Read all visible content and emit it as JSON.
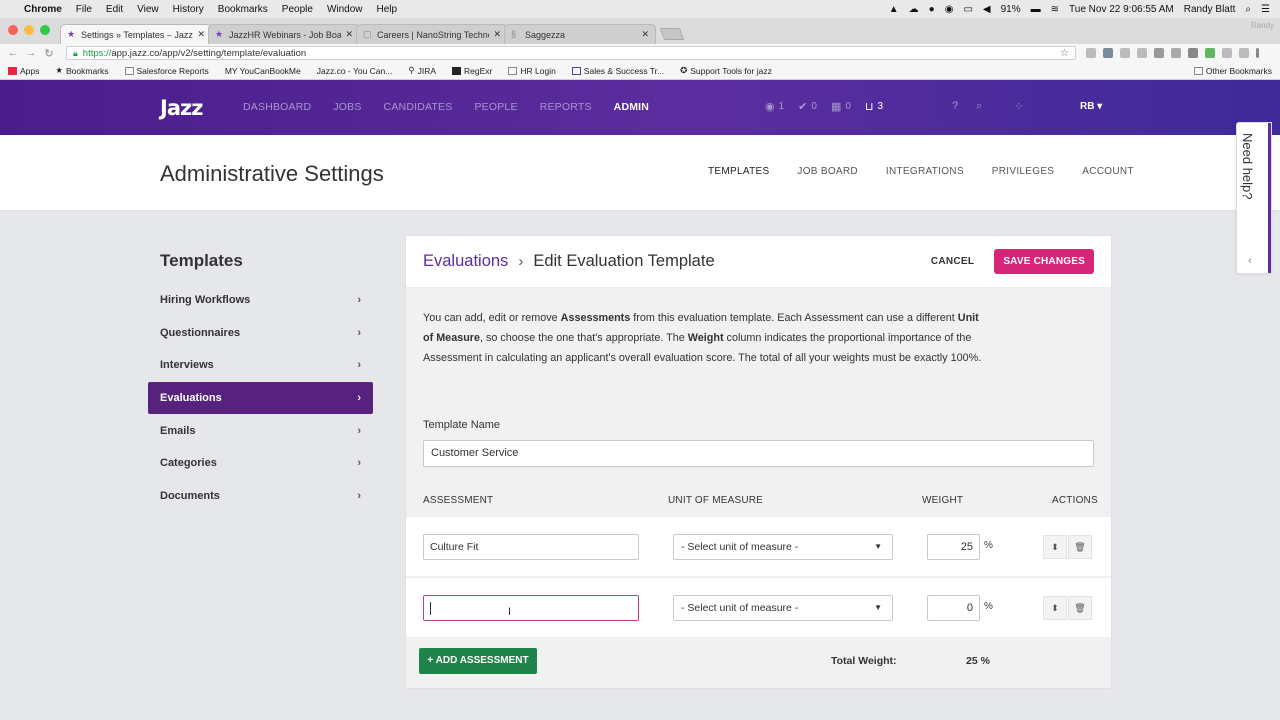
{
  "menubar": {
    "app": "Chrome",
    "items": [
      "File",
      "Edit",
      "View",
      "History",
      "Bookmarks",
      "People",
      "Window",
      "Help"
    ],
    "battery": "91%",
    "datetime": "Tue Nov 22  9:06:55 AM",
    "user": "Randy Blatt"
  },
  "browser": {
    "tabs": [
      {
        "title": "Settings » Templates – Jazz",
        "active": true
      },
      {
        "title": "JazzHR Webinars - Job Board",
        "active": false
      },
      {
        "title": "Careers | NanoString Technolo",
        "active": false
      },
      {
        "title": "Saggezza",
        "active": false
      }
    ],
    "profile": "Randy",
    "url_secure": "https://",
    "url_rest": "app.jazz.co/app/v2/setting/template/evaluation",
    "bookmarks": [
      "Apps",
      "Bookmarks",
      "Salesforce Reports",
      "MY YouCanBookMe",
      "Jazz.co - You Can...",
      "JIRA",
      "RegExr",
      "HR Login",
      "Sales & Success Tr...",
      "Support Tools for jazz"
    ],
    "other_bookmarks": "Other Bookmarks"
  },
  "app": {
    "logo": "Jazz",
    "nav": [
      "DASHBOARD",
      "JOBS",
      "CANDIDATES",
      "PEOPLE",
      "REPORTS",
      "ADMIN"
    ],
    "active_nav": "ADMIN",
    "counters": {
      "eye": "1",
      "check": "0",
      "calendar": "0",
      "inbox": "3"
    },
    "user_initials": "RB"
  },
  "page": {
    "title": "Administrative Settings",
    "subnav": [
      "TEMPLATES",
      "JOB BOARD",
      "INTEGRATIONS",
      "PRIVILEGES",
      "ACCOUNT"
    ],
    "active_subnav": "TEMPLATES"
  },
  "sidebar": {
    "title": "Templates",
    "items": [
      "Hiring Workflows",
      "Questionnaires",
      "Interviews",
      "Evaluations",
      "Emails",
      "Categories",
      "Documents"
    ],
    "active": "Evaluations"
  },
  "panel": {
    "breadcrumb_parent": "Evaluations",
    "breadcrumb_current": "Edit Evaluation Template",
    "cancel": "CANCEL",
    "save": "SAVE CHANGES",
    "desc": {
      "p1": "You can add, edit or remove ",
      "b1": "Assessments",
      "p2": " from this evaluation template. Each Assessment can use a different ",
      "b2": "Unit of Measure",
      "p3": ", so choose the one that's appropriate. The ",
      "b3": "Weight",
      "p4": " column indicates the proportional importance of the Assessment in calculating an applicant's overall evaluation score. The total of all your weights must be exactly 100%."
    },
    "template_name_label": "Template Name",
    "template_name_value": "Customer Service",
    "columns": {
      "assessment": "ASSESSMENT",
      "unit": "UNIT OF MEASURE",
      "weight": "WEIGHT",
      "actions": "ACTIONS"
    },
    "rows": [
      {
        "assessment": "Culture Fit",
        "unit": "- Select unit of measure -",
        "weight": "25"
      },
      {
        "assessment": "",
        "unit": "- Select unit of measure -",
        "weight": "0"
      }
    ],
    "percent_sign": "%",
    "add_button": "+ ADD ASSESSMENT",
    "total_label": "Total Weight:",
    "total_value": "25 %"
  },
  "help": {
    "label": "Need help?"
  }
}
